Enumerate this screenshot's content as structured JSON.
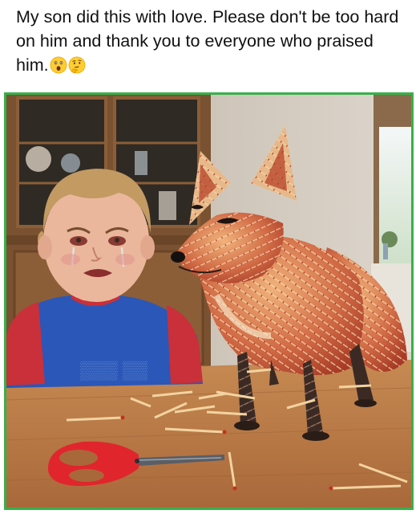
{
  "post": {
    "caption": "My son did this with love. Please don't be too hard on him and thank you to everyone who praised him.",
    "emojis": [
      "astonished-face",
      "thinking-face"
    ]
  },
  "photo": {
    "scene": [
      "crying-boy",
      "matchstick-fox-sculpture",
      "red-scissors",
      "scattered-matches",
      "wooden-table",
      "kitchen-cabinet",
      "window"
    ],
    "colors": {
      "frame": "#38b04a",
      "scissors": "#e0262c",
      "fox": "#c8553a"
    }
  }
}
